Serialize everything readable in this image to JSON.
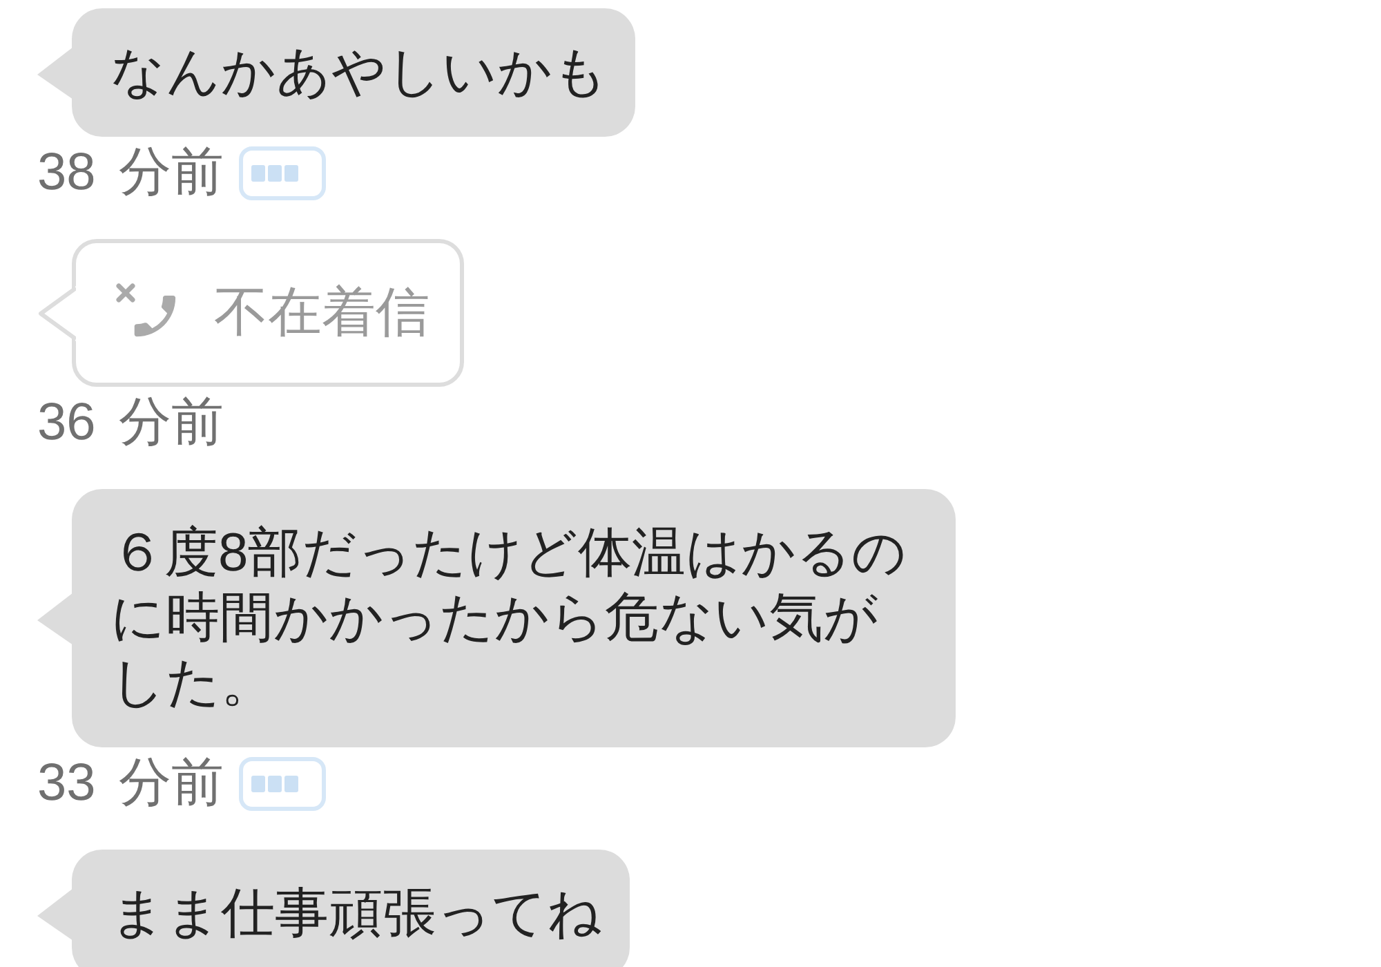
{
  "messages": [
    {
      "kind": "text",
      "text": "なんかあやしいかも",
      "time": "38 分前",
      "status_icon": true
    },
    {
      "kind": "missed_call",
      "text": "不在着信",
      "time": "36 分前",
      "status_icon": false
    },
    {
      "kind": "text",
      "text": "６度8部だったけど体温はかるのに時間かかったから危ない気がした。",
      "time": "33 分前",
      "status_icon": true
    },
    {
      "kind": "text",
      "text": "まま仕事頑張ってね"
    }
  ]
}
